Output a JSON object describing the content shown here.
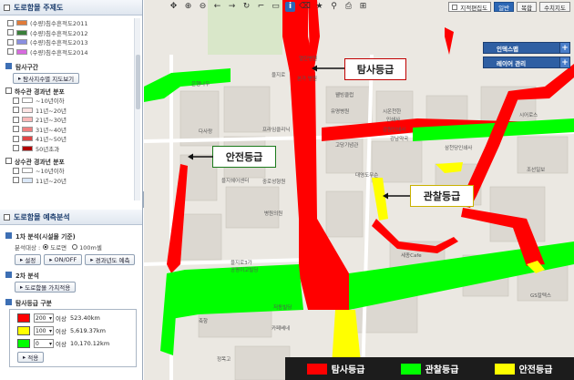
{
  "sidebar": {
    "sec1_title": "도로함몰 주제도",
    "layers": [
      {
        "label": "(수량)침수흔적도2011",
        "color": "#e07b3a"
      },
      {
        "label": "(수량)침수흔적도2012",
        "color": "#3a7f3a"
      },
      {
        "label": "(수량)침수흔적도2013",
        "color": "#8a8fe0"
      },
      {
        "label": "(수량)침수흔적도2014",
        "color": "#d76adf"
      }
    ],
    "survey_title": "탐사구간",
    "survey_btn": "탐사지수별 지도보기",
    "sewer_title": "하수관 경과년 분포",
    "sewer_items": [
      "~10년이하",
      "11년~20년",
      "21년~30년",
      "31년~40년",
      "41년~50년",
      "50년초과"
    ],
    "water_title": "상수관 경과년 분포",
    "water_items": [
      "~10년이하",
      "11년~20년"
    ],
    "sec2_title": "도로함몰 예측분석",
    "step1_title": "1차 분석(시설물 기준)",
    "target_label": "분석대상 :",
    "target_opt1": "도로면",
    "target_opt2": "100m셀",
    "btn_setting": "설정",
    "btn_onoff": "ON/OFF",
    "btn_year": "경과년도 예측",
    "step2_title": "2차 분석",
    "btn_value": "도로함몰 가치적용",
    "grade_title": "탐사등급 구분",
    "grades": [
      {
        "color": "#ff0000",
        "value": "200",
        "suffix": "이상",
        "length": "523.40km"
      },
      {
        "color": "#ffff00",
        "value": "100",
        "suffix": "이상",
        "length": "5,619.37km"
      },
      {
        "color": "#00ff00",
        "value": "0",
        "suffix": "이상",
        "length": "10,170.12km"
      }
    ],
    "btn_apply": "적용"
  },
  "toolbar": {
    "icons": [
      "move-icon",
      "zoom-in-icon",
      "zoom-out-icon",
      "previous-icon",
      "next-icon",
      "refresh-icon",
      "distance-icon",
      "area-icon",
      "info-icon",
      "clear-icon",
      "favorite-icon",
      "pin-icon",
      "print-icon",
      "save-icon"
    ],
    "glyphs": [
      "✥",
      "⊕",
      "⊖",
      "←",
      "→",
      "↻",
      "⌐",
      "▭",
      "i",
      "⌫",
      "★",
      "⚲",
      "⎙",
      "⊞"
    ],
    "jijeok_label": "지적편집도",
    "map_types": [
      "일반",
      "복합",
      "수치지도"
    ]
  },
  "overlays": {
    "index_map": "인덱스맵",
    "layer_mgmt": "레이어 관리"
  },
  "callouts": {
    "explore": "탐사등급",
    "safe": "안전등급",
    "observe": "관찰등급"
  },
  "legend": {
    "items": [
      {
        "label": "탐사등급",
        "color": "#ff0000"
      },
      {
        "label": "관찰등급",
        "color": "#00ff00"
      },
      {
        "label": "안전등급",
        "color": "#ffff00"
      }
    ]
  },
  "map_labels": [
    "열린병원",
    "을지로",
    "은행나무",
    "프라임클리닉",
    "본가 병원",
    "웰빙클럽",
    "유명병원",
    "강남약국",
    "다사랑",
    "시온천한",
    "인쇄사",
    "강원인쇄사",
    "고당기념관",
    "대영도무슨",
    "삼천당인쇄사",
    "시어로스",
    "조선일보",
    "을지쉐어센터",
    "중로성형원",
    "병원의원",
    "을지로3가",
    "공평이고빌딩",
    "세종Cafe",
    "GS칼텍스",
    "저동빌딩",
    "카페베네",
    "정목고",
    "축항"
  ]
}
